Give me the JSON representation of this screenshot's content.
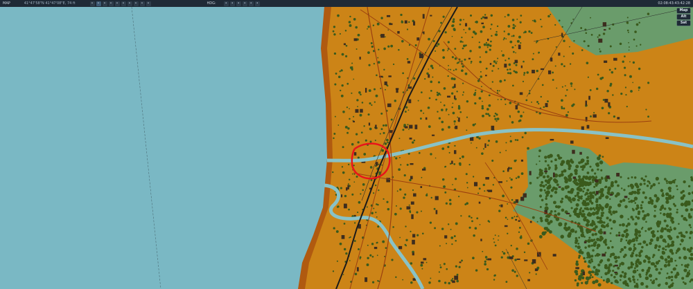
{
  "toolbar": {
    "title": "MAP",
    "coordinates": "41°47'58\"N 41°47'08\"E, 74 ft",
    "heading_label": "HDG:",
    "clock": "02:08:43:43:42:28",
    "tools_left": [
      "cursor-icon",
      "grid-icon",
      "circle-icon",
      "ruler-icon",
      "target-icon",
      "waypoint-icon",
      "flag-icon",
      "pin-icon",
      "eye-icon",
      "layers-icon"
    ],
    "tools_right": [
      "arrow-icon",
      "zoom-in-icon",
      "zoom-out-icon",
      "search-icon",
      "fit-icon",
      "measure-icon"
    ]
  },
  "layers": {
    "map": "Map",
    "alt": "Alt",
    "sat": "Sat"
  },
  "colors": {
    "sea": "#7ab8c4",
    "land": "#cc8417",
    "coast": "#b05a10",
    "forest": "#3a5a1c",
    "clearing": "#6a9c6b",
    "river": "#89c2c6",
    "road": "#9b3f10",
    "railway": "#1a1a1a",
    "marker": "#e8141b"
  },
  "map": {
    "marker_shape": "circle",
    "features": [
      "sea",
      "coastline",
      "town",
      "river",
      "railway",
      "roads",
      "forest",
      "clearing",
      "buildings"
    ]
  }
}
